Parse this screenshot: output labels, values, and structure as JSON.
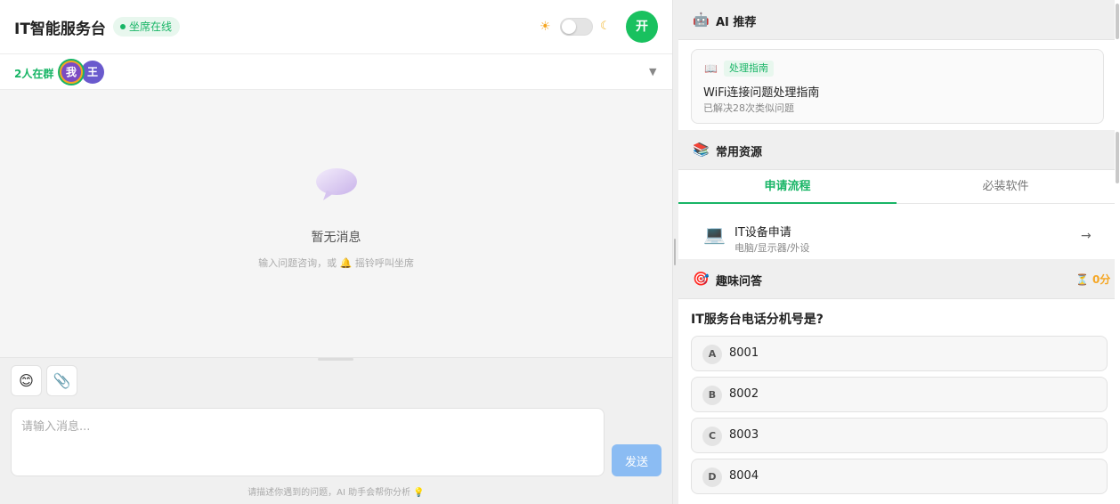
{
  "header": {
    "title": "IT智能服务台",
    "status": "坐席在线",
    "sun_icon": "☀",
    "moon_icon": "☾",
    "avatar_label": "开",
    "accent_color": "#19c15f"
  },
  "members": {
    "count_label": "2人在群",
    "list": [
      {
        "label": "我"
      },
      {
        "label": "王"
      }
    ],
    "caret": "▼"
  },
  "chat": {
    "empty_title": "暂无消息",
    "empty_hint_before": "输入问题咨询，或",
    "bell_icon": "🔔",
    "empty_hint_after": "摇铃呼叫坐席"
  },
  "composer": {
    "emoji_icon": "😊",
    "attach_icon": "📎",
    "placeholder": "请输入消息...",
    "send_label": "发送",
    "hint": "请描述你遇到的问题，AI 助手会帮你分析",
    "bulb_icon": "💡"
  },
  "ai_section": {
    "icon": "🤖",
    "title": "AI 推荐",
    "card": {
      "book_icon": "📖",
      "tag": "处理指南",
      "title": "WiFi连接问题处理指南",
      "subtitle": "已解决28次类似问题"
    }
  },
  "resources": {
    "icon": "📚",
    "title": "常用资源",
    "tabs": [
      {
        "label": "申请流程",
        "active": true
      },
      {
        "label": "必装软件",
        "active": false
      }
    ],
    "items": [
      {
        "icon": "💻",
        "title": "IT设备申请",
        "subtitle": "电脑/显示器/外设",
        "arrow": "→"
      }
    ]
  },
  "quiz": {
    "icon": "🎯",
    "title": "趣味问答",
    "hourglass_icon": "⏳",
    "score": "0分",
    "question": "IT服务台电话分机号是?",
    "options": [
      {
        "letter": "A",
        "text": "8001"
      },
      {
        "letter": "B",
        "text": "8002"
      },
      {
        "letter": "C",
        "text": "8003"
      },
      {
        "letter": "D",
        "text": "8004"
      }
    ]
  }
}
